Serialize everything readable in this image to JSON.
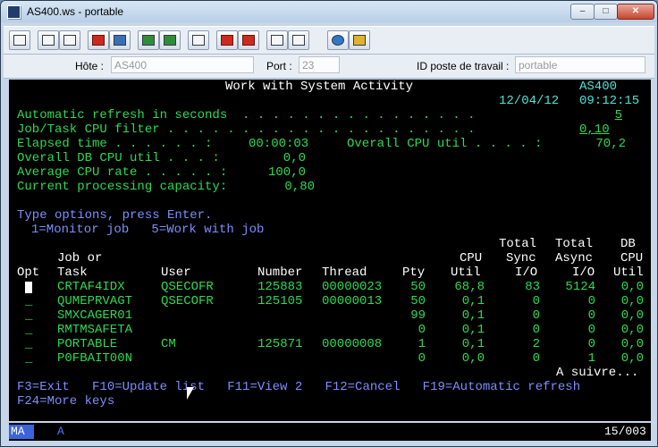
{
  "window": {
    "title": "AS400.ws - portable",
    "minimize_label": "–",
    "maximize_label": "□",
    "close_label": "✕"
  },
  "toolbar": {
    "buttons": [
      "print-screen",
      "copy",
      "paste",
      "send",
      "receive",
      "display",
      "keyboard",
      "record-macro",
      "stop-macro",
      "play-macro",
      "run-macro",
      "help-globe",
      "keymap"
    ]
  },
  "infobar": {
    "host_label": "Hôte :",
    "host_value": "AS400",
    "port_label": "Port :",
    "port_value": "23",
    "workstation_label": "ID poste de travail :",
    "workstation_value": "portable"
  },
  "terminal": {
    "title": "Work with System Activity",
    "system": "AS400",
    "date": "12/04/12",
    "time": "09:12:15",
    "refresh_label": "Automatic refresh in seconds  . . . . . . . . . . . . . . . .",
    "refresh_value": "5",
    "filter_label": "Job/Task CPU filter . . . . . . . . . . . . . . . . . . . . .",
    "filter_value": "0,10",
    "elapsed_label": "Elapsed time . . . . . . :",
    "elapsed_value": "00:00:03",
    "overall_cpu_label": "Overall CPU util . . . . :",
    "overall_cpu_value": "70,2",
    "db_cpu_label": "Overall DB CPU util . . . :",
    "db_cpu_value": "0,0",
    "avg_cpu_label": "Average CPU rate . . . . . :",
    "avg_cpu_value": "100,0",
    "capacity_label": "Current processing capacity:",
    "capacity_value": "0,80",
    "instructions": "Type options, press Enter.",
    "options": "1=Monitor job   5=Work with job",
    "headers_top": {
      "total_sync": "Total",
      "total_async": "Total",
      "db": "DB"
    },
    "headers_mid": {
      "job": "Job or",
      "cpu": "CPU",
      "sync": "Sync",
      "async": "Async",
      "db_cpu": "CPU"
    },
    "headers_bottom": {
      "opt": "Opt",
      "task": "Task",
      "user": "User",
      "number": "Number",
      "thread": "Thread",
      "pty": "Pty",
      "util": "Util",
      "sync_io": "I/O",
      "async_io": "I/O",
      "db_util": "Util"
    },
    "rows": [
      {
        "opt": "",
        "task": "CRTAF4IDX",
        "user": "QSECOFR",
        "number": "125883",
        "thread": "00000023",
        "pty": "50",
        "cpu": "68,8",
        "sync": "83",
        "async": "5124",
        "db": "0,0"
      },
      {
        "opt": "_",
        "task": "QUMEPRVAGT",
        "user": "QSECOFR",
        "number": "125105",
        "thread": "00000013",
        "pty": "50",
        "cpu": "0,1",
        "sync": "0",
        "async": "0",
        "db": "0,0"
      },
      {
        "opt": "_",
        "task": "SMXCAGER01",
        "user": "",
        "number": "",
        "thread": "",
        "pty": "99",
        "cpu": "0,1",
        "sync": "0",
        "async": "0",
        "db": "0,0"
      },
      {
        "opt": "_",
        "task": "RMTMSAFETA",
        "user": "",
        "number": "",
        "thread": "",
        "pty": "0",
        "cpu": "0,1",
        "sync": "0",
        "async": "0",
        "db": "0,0"
      },
      {
        "opt": "_",
        "task": "PORTABLE",
        "user": "CM",
        "number": "125871",
        "thread": "00000008",
        "pty": "1",
        "cpu": "0,1",
        "sync": "2",
        "async": "0",
        "db": "0,0"
      },
      {
        "opt": "_",
        "task": "P0FBAIT00N",
        "user": "",
        "number": "",
        "thread": "",
        "pty": "0",
        "cpu": "0,0",
        "sync": "0",
        "async": "1",
        "db": "0,0"
      }
    ],
    "more": "A suivre...",
    "fkeys1": "F3=Exit   F10=Update list   F11=View 2   F12=Cancel   F19=Automatic refresh",
    "fkeys2": "F24=More keys"
  },
  "statusbar": {
    "mode": "MA",
    "indicator": "A",
    "page": "15/003"
  }
}
